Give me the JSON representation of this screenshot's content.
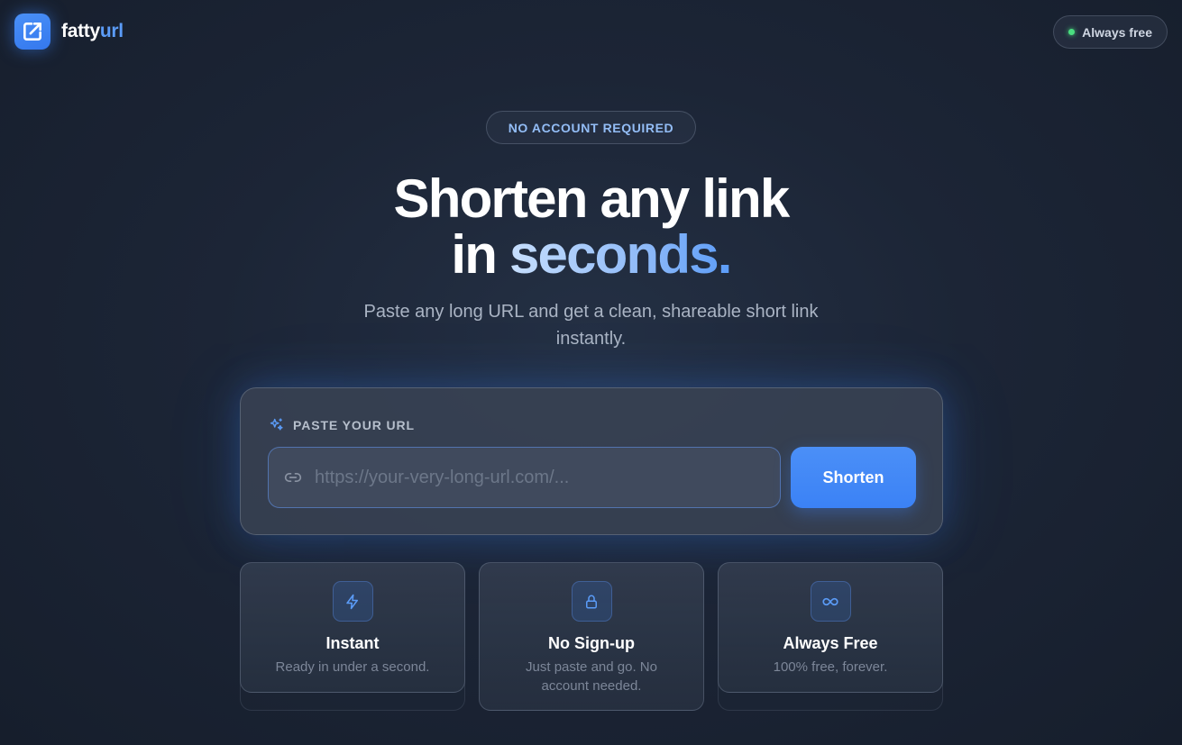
{
  "header": {
    "logo_text_a": "fatty",
    "logo_text_b": "url",
    "status_pill": "Always free",
    "status_dot_color": "#4ade80"
  },
  "hero": {
    "badge": "NO ACCOUNT REQUIRED",
    "headline_line1": "Shorten any link",
    "headline_line2_plain": "in",
    "headline_line2_accent": "seconds.",
    "subtitle": "Paste any long URL and get a clean, shareable short link instantly."
  },
  "form": {
    "label": "PASTE YOUR URL",
    "input_value": "",
    "input_placeholder": "https://your-very-long-url.com/...",
    "submit_label": "Shorten",
    "accent_color": "#3b82f6"
  },
  "features": [
    {
      "icon": "lightning-icon",
      "title": "Instant",
      "description": "Ready in under a second."
    },
    {
      "icon": "lock-icon",
      "title": "No Sign-up",
      "description": "Just paste and go. No account needed."
    },
    {
      "icon": "infinity-icon",
      "title": "Always Free",
      "description": "100% free, forever."
    }
  ]
}
